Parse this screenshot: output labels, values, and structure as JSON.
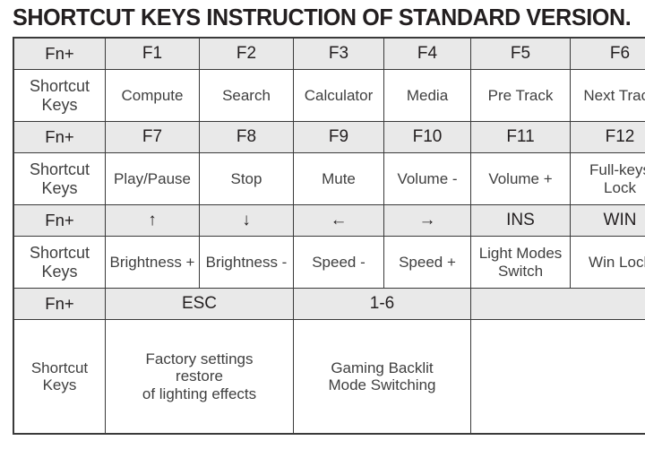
{
  "title": "SHORTCUT KEYS INSTRUCTION OF STANDARD VERSION.",
  "labels": {
    "fn": "Fn+",
    "shortcut_keys": "Shortcut\nKeys"
  },
  "colors": {
    "header_bg": "#e9e9e9",
    "cell_bg": "#ffffff",
    "border": "#3a3a3a",
    "text": "#231f20",
    "value_text": "#3f3f3f"
  },
  "table": {
    "blocks": [
      {
        "keys": [
          "F1",
          "F2",
          "F3",
          "F4",
          "F5",
          "F6"
        ],
        "values": [
          "Compute",
          "Search",
          "Calculator",
          "Media",
          "Pre Track",
          "Next Track"
        ]
      },
      {
        "keys": [
          "F7",
          "F8",
          "F9",
          "F10",
          "F11",
          "F12"
        ],
        "values": [
          "Play/Pause",
          "Stop",
          "Mute",
          "Volume -",
          "Volume +",
          "Full-keys\nLock"
        ]
      },
      {
        "keys": [
          "↑",
          "↓",
          "←",
          "→",
          "INS",
          "WIN"
        ],
        "values": [
          "Brightness +",
          "Brightness -",
          "Speed -",
          "Speed +",
          "Light Modes\nSwitch",
          "Win Lock"
        ]
      }
    ],
    "final_block": {
      "keys": [
        "ESC",
        "1-6",
        ""
      ],
      "values": [
        "Factory settings\nrestore\nof lighting effects",
        "Gaming Backlit\nMode Switching",
        ""
      ]
    }
  }
}
